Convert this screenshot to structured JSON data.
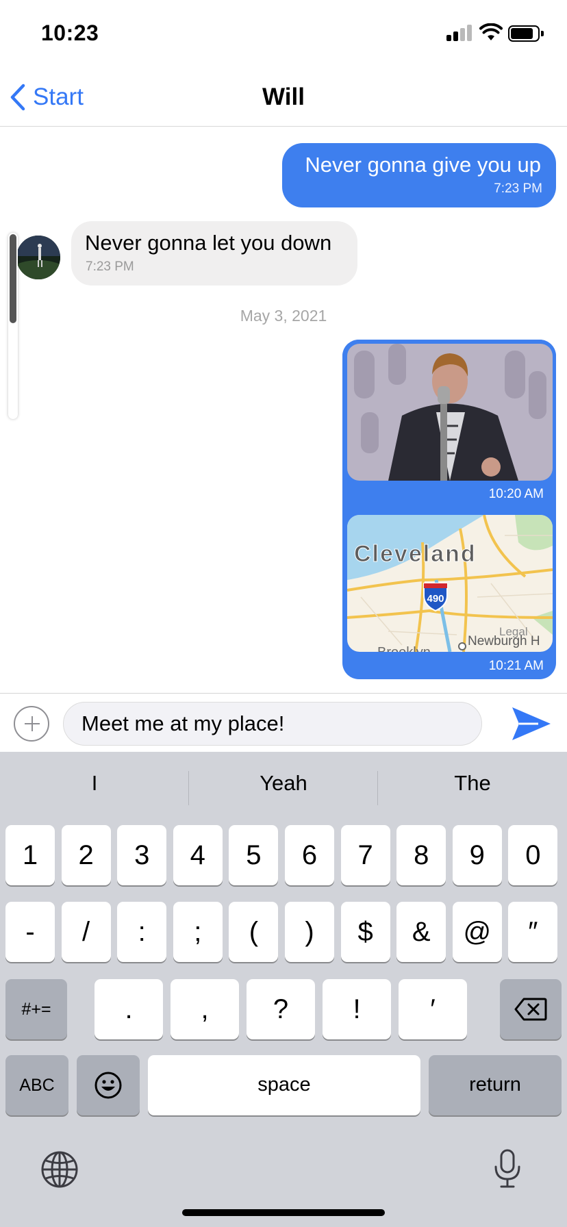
{
  "status_bar": {
    "time": "10:23"
  },
  "nav": {
    "back_label": "Start",
    "title": "Will"
  },
  "chat": {
    "messages": [
      {
        "text": "Never gonna give you up",
        "time": "7:23 PM"
      },
      {
        "text": "Never gonna let you down",
        "time": "7:23 PM"
      }
    ],
    "date_separator": "May 3, 2021",
    "video_message": {
      "time": "10:20 AM"
    },
    "location_message": {
      "time": "10:21 AM",
      "map_city": "Cleveland",
      "map_shield": "490",
      "map_labels": [
        "Brooklyn",
        "Newburgh H",
        "Legal"
      ]
    }
  },
  "composer": {
    "input_value": "Meet me at my place!"
  },
  "keyboard": {
    "suggestions": [
      "I",
      "Yeah",
      "The"
    ],
    "row1": [
      "1",
      "2",
      "3",
      "4",
      "5",
      "6",
      "7",
      "8",
      "9",
      "0"
    ],
    "row2": [
      "-",
      "/",
      ":",
      ";",
      "(",
      ")",
      "$",
      "&",
      "@",
      "″"
    ],
    "row3": [
      ".",
      ",",
      "?",
      "!",
      "′"
    ],
    "symbols_key": "#+=",
    "abc_key": "ABC",
    "space_key": "space",
    "return_key": "return"
  },
  "colors": {
    "accent": "#3478f6",
    "bubble_out": "#3e7fee",
    "bubble_in": "#f0efef",
    "keyboard_bg": "#d1d3d9"
  },
  "icons": [
    "back-chevron-icon",
    "add-icon",
    "send-icon",
    "emoji-icon",
    "globe-icon",
    "microphone-icon",
    "delete-icon"
  ]
}
